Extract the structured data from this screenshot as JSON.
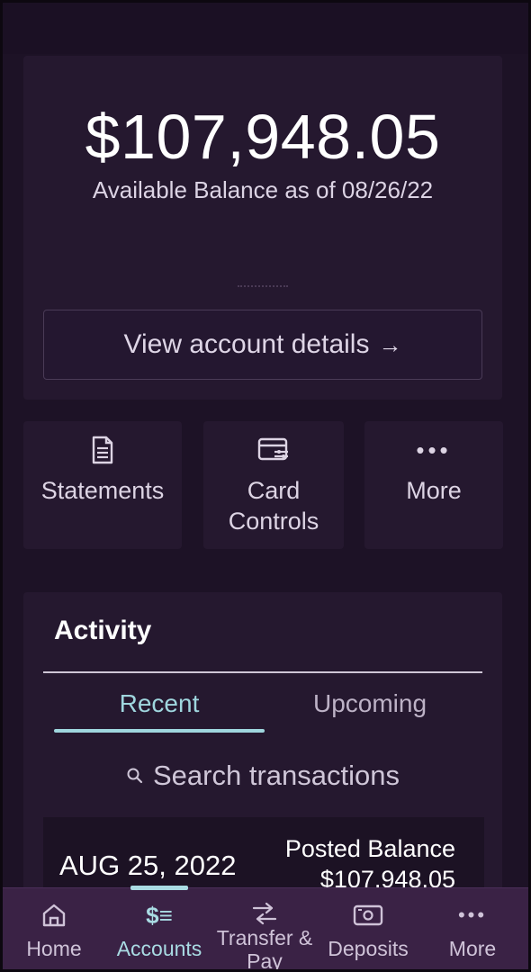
{
  "balance": {
    "amount": "$107,948.05",
    "caption": "Available Balance as of 08/26/22",
    "view_details_label": "View account details",
    "view_details_arrow": "→"
  },
  "actions": {
    "statements_label": "Statements",
    "card_controls_label_line1": "Card",
    "card_controls_label_line2": "Controls",
    "more_label": "More",
    "more_icon_glyph": "•••"
  },
  "activity": {
    "title": "Activity",
    "tabs": [
      {
        "label": "Recent",
        "selected": true
      },
      {
        "label": "Upcoming",
        "selected": false
      }
    ],
    "search_placeholder": "Search transactions",
    "rows": [
      {
        "date": "AUG 25, 2022",
        "balance_label": "Posted Balance",
        "balance_value": "$107,948.05"
      }
    ]
  },
  "nav": {
    "home": "Home",
    "accounts": "Accounts",
    "accounts_icon_glyph": "$≡",
    "transfer_line1": "Transfer &",
    "transfer_line2": "Pay",
    "deposits": "Deposits",
    "more": "More",
    "more_icon_glyph": "•••"
  },
  "colors": {
    "background": "#1d1226",
    "card": "#25182f",
    "accent": "#9fd6de",
    "nav_background": "#3a2245"
  }
}
